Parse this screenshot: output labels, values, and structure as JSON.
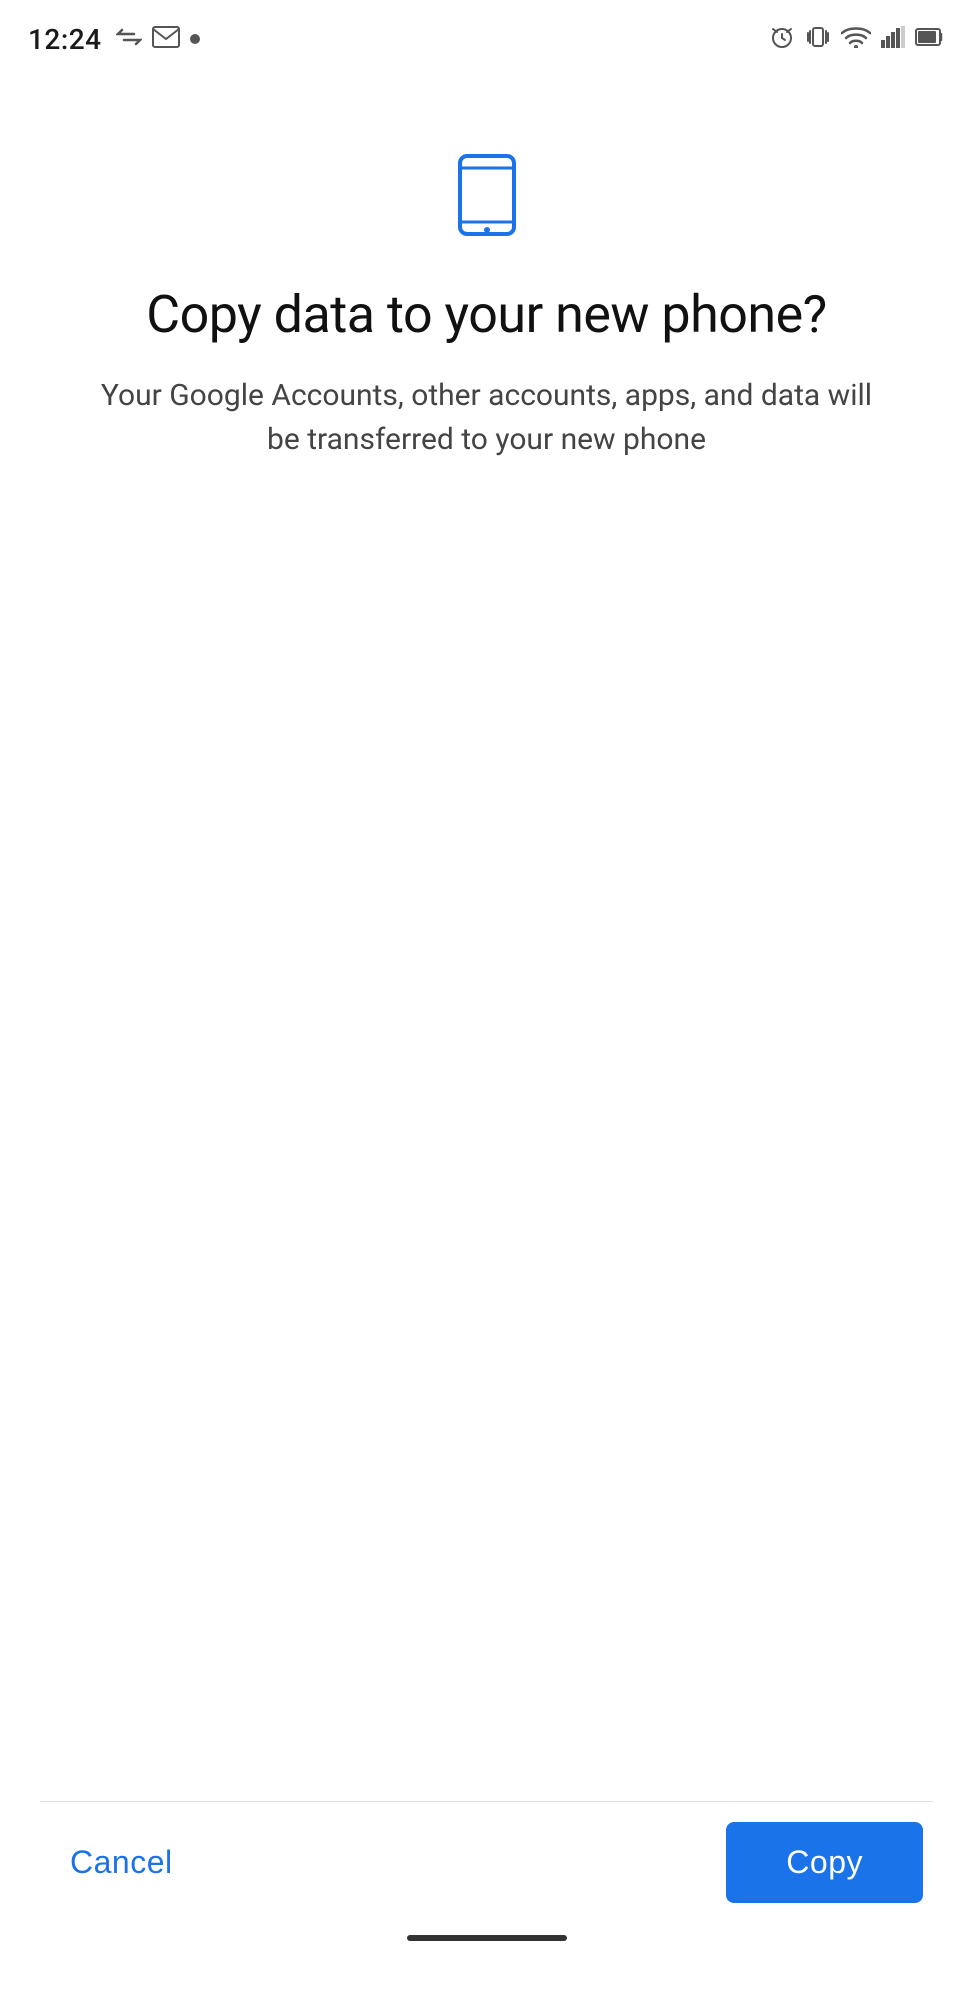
{
  "statusBar": {
    "time": "12:24",
    "leftIcons": [
      "arrow-transfer-icon",
      "gmail-icon",
      "dot-icon"
    ],
    "rightIcons": [
      "alarm-icon",
      "vibrate-icon",
      "wifi-icon",
      "signal-icon",
      "battery-icon"
    ]
  },
  "page": {
    "phoneIcon": "📱",
    "title": "Copy data to your new phone?",
    "subtitle": "Your Google Accounts, other accounts, apps, and data will be transferred to your new phone",
    "cancelLabel": "Cancel",
    "copyLabel": "Copy"
  }
}
